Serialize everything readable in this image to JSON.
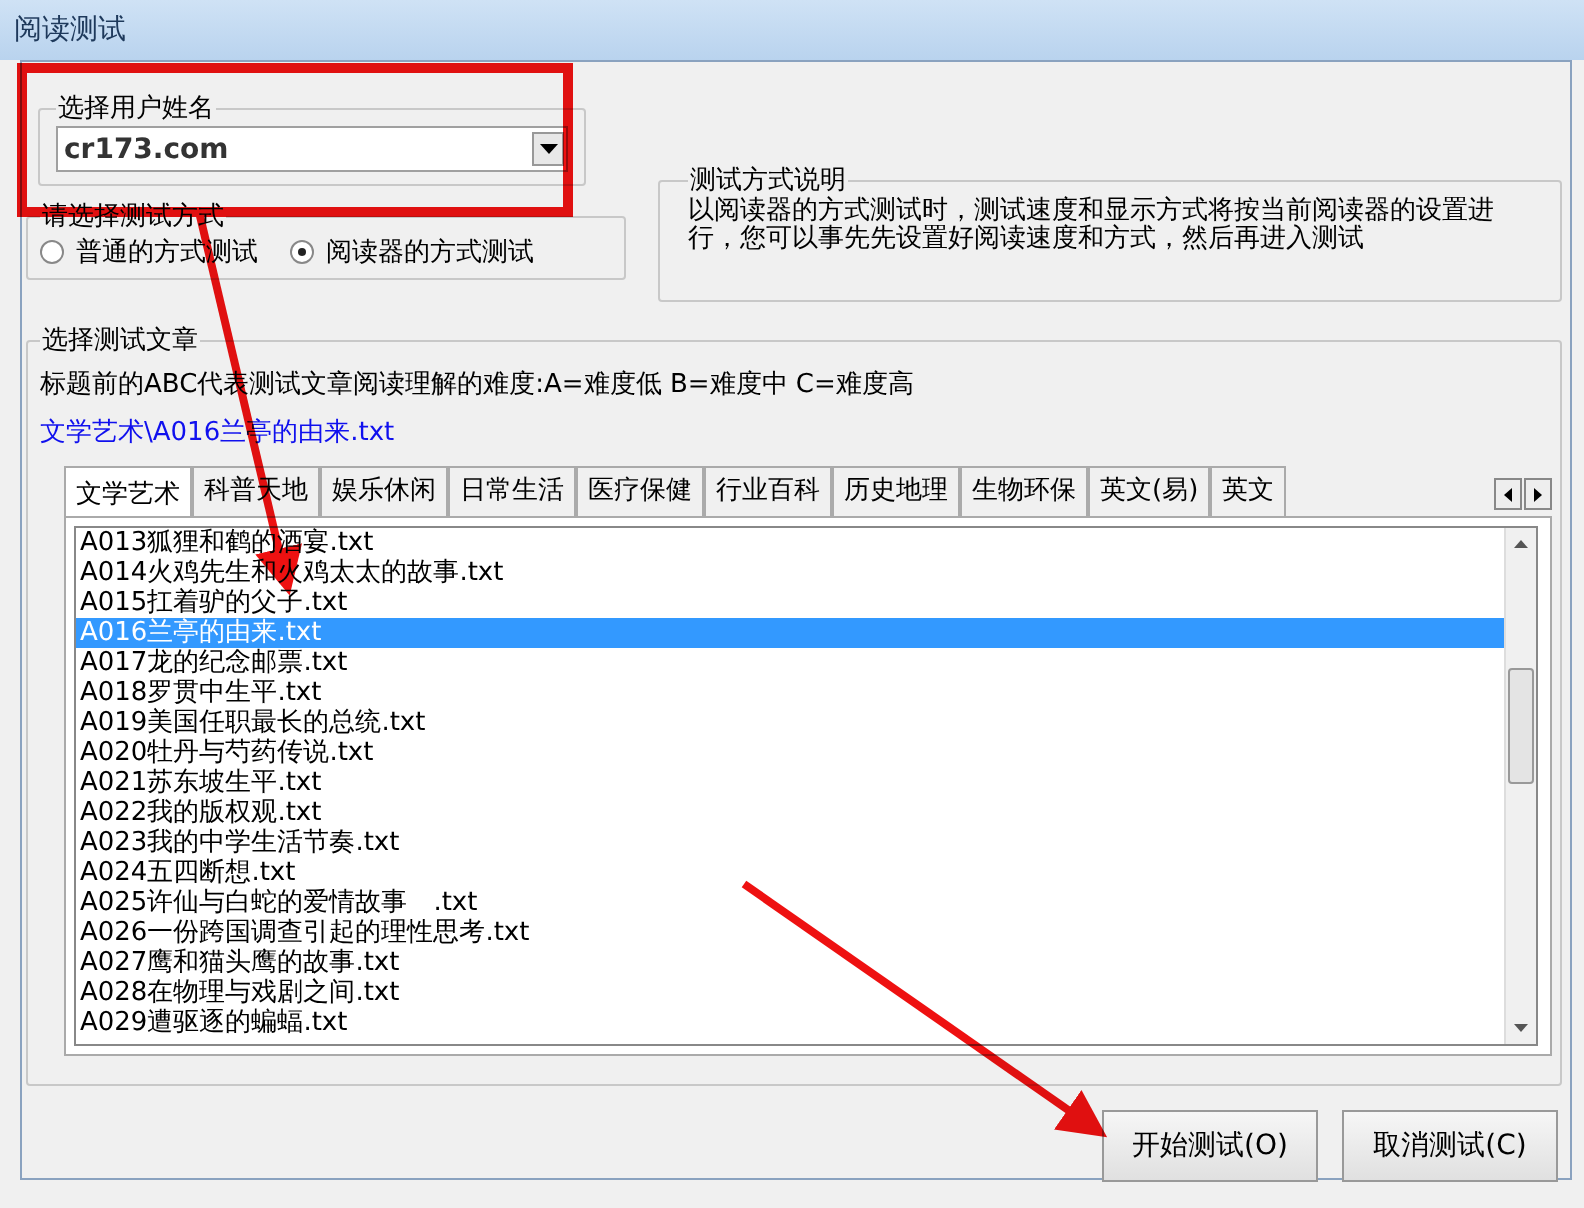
{
  "window": {
    "title": "阅读测试"
  },
  "user_group": {
    "title": "选择用户姓名",
    "value": "cr173.com"
  },
  "mode_group": {
    "title": "请选择测试方式",
    "options": [
      {
        "label": "普通的方式测试",
        "selected": false
      },
      {
        "label": "阅读器的方式测试",
        "selected": true
      }
    ]
  },
  "mode_info": {
    "title": "测试方式说明",
    "text": "以阅读器的方式测试时，测试速度和显示方式将按当前阅读器的设置进行，您可以事先先设置好阅读速度和方式，然后再进入测试"
  },
  "article_group": {
    "title": "选择测试文章",
    "hint": "标题前的ABC代表测试文章阅读理解的难度:A=难度低 B=难度中 C=难度高",
    "path": "文学艺术\\A016兰亭的由来.txt"
  },
  "tabs": [
    {
      "label": "文学艺术",
      "selected": true
    },
    {
      "label": "科普天地",
      "selected": false
    },
    {
      "label": "娱乐休闲",
      "selected": false
    },
    {
      "label": "日常生活",
      "selected": false
    },
    {
      "label": "医疗保健",
      "selected": false
    },
    {
      "label": "行业百科",
      "selected": false
    },
    {
      "label": "历史地理",
      "selected": false
    },
    {
      "label": "生物环保",
      "selected": false
    },
    {
      "label": "英文(易)",
      "selected": false
    },
    {
      "label": "英文",
      "selected": false
    }
  ],
  "files": [
    {
      "name": "A013狐狸和鹤的酒宴.txt",
      "selected": false
    },
    {
      "name": "A014火鸡先生和火鸡太太的故事.txt",
      "selected": false
    },
    {
      "name": "A015扛着驴的父子.txt",
      "selected": false
    },
    {
      "name": "A016兰亭的由来.txt",
      "selected": true
    },
    {
      "name": "A017龙的纪念邮票.txt",
      "selected": false
    },
    {
      "name": "A018罗贯中生平.txt",
      "selected": false
    },
    {
      "name": "A019美国任职最长的总统.txt",
      "selected": false
    },
    {
      "name": "A020牡丹与芍药传说.txt",
      "selected": false
    },
    {
      "name": "A021苏东坡生平.txt",
      "selected": false
    },
    {
      "name": "A022我的版权观.txt",
      "selected": false
    },
    {
      "name": "A023我的中学生活节奏.txt",
      "selected": false
    },
    {
      "name": "A024五四断想.txt",
      "selected": false
    },
    {
      "name": "A025许仙与白蛇的爱情故事　.txt",
      "selected": false
    },
    {
      "name": "A026一份跨国调查引起的理性思考.txt",
      "selected": false
    },
    {
      "name": "A027鹰和猫头鹰的故事.txt",
      "selected": false
    },
    {
      "name": "A028在物理与戏剧之间.txt",
      "selected": false
    },
    {
      "name": "A029遭驱逐的蝙蝠.txt",
      "selected": false
    }
  ],
  "buttons": [
    "开始测试(O)",
    "取消测试(C)"
  ]
}
